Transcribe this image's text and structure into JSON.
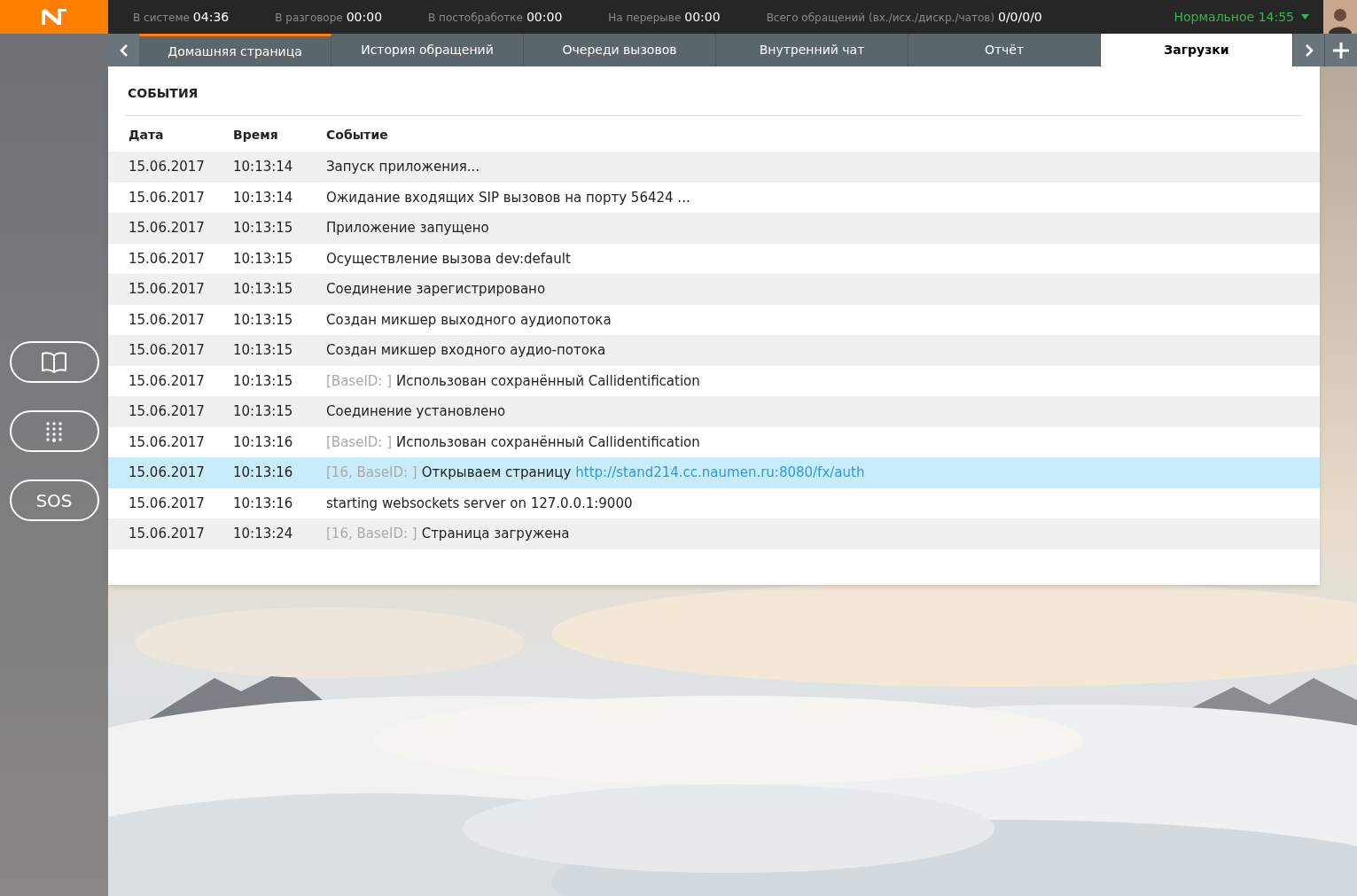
{
  "status_bar": {
    "stats": [
      {
        "label": "В системе",
        "value": "04:36"
      },
      {
        "label": "В разговоре",
        "value": "00:00"
      },
      {
        "label": "В постобработке",
        "value": "00:00"
      },
      {
        "label": "На перерыве",
        "value": "00:00"
      },
      {
        "label": "Всего обращений (вх./исх./дискр./чатов)",
        "value": "0/0/0/0"
      }
    ],
    "status": {
      "label": "Нормальное",
      "time": "14:55"
    }
  },
  "tabs": [
    {
      "label": "Домашняя страница",
      "selected": false,
      "accent": true
    },
    {
      "label": "История обращений",
      "selected": false,
      "accent": false
    },
    {
      "label": "Очереди вызовов",
      "selected": false,
      "accent": false
    },
    {
      "label": "Внутренний чат",
      "selected": false,
      "accent": false
    },
    {
      "label": "Отчёт",
      "selected": false,
      "accent": false
    },
    {
      "label": "Загрузки",
      "selected": true,
      "accent": false
    }
  ],
  "sidebar": {
    "buttons": [
      {
        "kind": "book"
      },
      {
        "kind": "dialpad"
      },
      {
        "kind": "text",
        "label": "SOS"
      }
    ]
  },
  "events": {
    "title": "СОБЫТИЯ",
    "columns": [
      "Дата",
      "Время",
      "Событие"
    ],
    "rows": [
      {
        "date": "15.06.2017",
        "time": "10:13:14",
        "text": "Запуск приложения...",
        "selected": false
      },
      {
        "date": "15.06.2017",
        "time": "10:13:14",
        "text": "Ожидание входящих SIP вызовов на порту 56424 ...",
        "selected": false
      },
      {
        "date": "15.06.2017",
        "time": "10:13:15",
        "text": "Приложение запущено",
        "selected": false
      },
      {
        "date": "15.06.2017",
        "time": "10:13:15",
        "text": "Осуществление вызова dev:default",
        "selected": false
      },
      {
        "date": "15.06.2017",
        "time": "10:13:15",
        "text": "Соединение зарегистрировано",
        "selected": false
      },
      {
        "date": "15.06.2017",
        "time": "10:13:15",
        "text": "Создан микшер выходного аудиопотока",
        "selected": false
      },
      {
        "date": "15.06.2017",
        "time": "10:13:15",
        "text": "Создан микшер входного аудио-потока",
        "selected": false
      },
      {
        "date": "15.06.2017",
        "time": "10:13:15",
        "prefix": "[BaseID: ]",
        "text": "Использован сохранённый Callidentification",
        "selected": false
      },
      {
        "date": "15.06.2017",
        "time": "10:13:15",
        "text": "Соединение установлено",
        "selected": false
      },
      {
        "date": "15.06.2017",
        "time": "10:13:16",
        "prefix": "[BaseID: ]",
        "text": "Использован сохранённый Callidentification",
        "selected": false
      },
      {
        "date": "15.06.2017",
        "time": "10:13:16",
        "prefix": "[16, BaseID: ]",
        "text": "Открываем страницу",
        "link": "http://stand214.cc.naumen.ru:8080/fx/auth",
        "selected": true
      },
      {
        "date": "15.06.2017",
        "time": "10:13:16",
        "text": "starting websockets server on 127.0.0.1:9000",
        "selected": false
      },
      {
        "date": "15.06.2017",
        "time": "10:13:24",
        "prefix": "[16, BaseID: ]",
        "text": "Страница загружена",
        "selected": false
      }
    ]
  }
}
